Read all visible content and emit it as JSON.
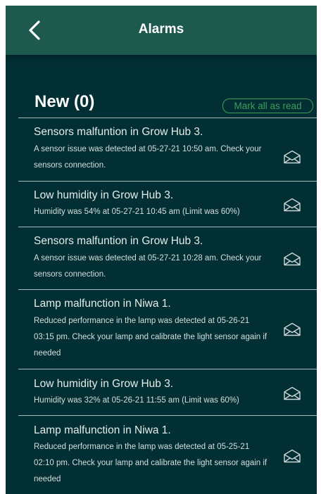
{
  "header": {
    "title": "Alarms",
    "back_icon": "chevron-left-icon"
  },
  "section": {
    "title": "New (0)",
    "mark_all_label": "Mark all as read"
  },
  "colors": {
    "background": "#022f34",
    "header": "#1d594d",
    "accent": "#3e9d5a"
  },
  "notifications": [
    {
      "title": "Sensors malfuntion in Grow Hub 3.",
      "body": "A sensor issue was detected at 05-27-21 10:50 am. Check your sensors connection.",
      "icon": "envelope-open-icon"
    },
    {
      "title": "Low humidity in Grow Hub 3.",
      "body": "Humidity was 54% at 05-27-21 10:45 am (Limit was 60%)",
      "icon": "envelope-open-icon"
    },
    {
      "title": "Sensors malfuntion in Grow Hub 3.",
      "body": "A sensor issue was detected at 05-27-21 10:28 am. Check your sensors connection.",
      "icon": "envelope-open-icon"
    },
    {
      "title": "Lamp malfunction in Niwa 1.",
      "body": "Reduced performance in the lamp was detected at 05-26-21 03:15 pm. Check your lamp and calibrate the light sensor again if needed",
      "icon": "envelope-open-icon"
    },
    {
      "title": "Low humidity in Grow Hub 3.",
      "body": "Humidity was 32% at 05-26-21 11:55 am (Limit was 60%)",
      "icon": "envelope-open-icon"
    },
    {
      "title": "Lamp malfunction in Niwa 1.",
      "body": "Reduced performance in the lamp was detected at 05-25-21 02:10 pm. Check your lamp and calibrate the light sensor again if needed",
      "icon": "envelope-open-icon"
    }
  ]
}
